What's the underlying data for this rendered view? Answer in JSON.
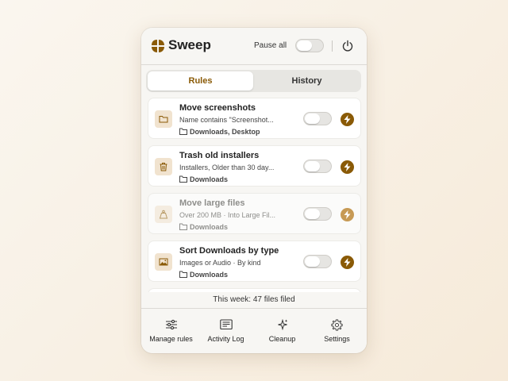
{
  "header": {
    "app_title": "Sweep",
    "pause_label": "Pause all",
    "pause_all_on": false,
    "logo_icon": "four-leaf-logo",
    "power_icon": "power-icon",
    "brand_color": "#8a5a06"
  },
  "tabs": [
    {
      "label": "Rules",
      "active": true
    },
    {
      "label": "History",
      "active": false
    }
  ],
  "rules": [
    {
      "title": "Move screenshots",
      "description": "Name contains \"Screenshot...",
      "folders": "Downloads, Desktop",
      "icon": "folder-icon",
      "enabled": false,
      "dimmed": false
    },
    {
      "title": "Trash old installers",
      "description": "Installers, Older than 30 day...",
      "folders": "Downloads",
      "icon": "trash-icon",
      "enabled": false,
      "dimmed": false
    },
    {
      "title": "Move large files",
      "description": "Over 200 MB · Into Large Fil...",
      "folders": "Downloads",
      "icon": "weight-icon",
      "enabled": false,
      "dimmed": true
    },
    {
      "title": "Sort Downloads by type",
      "description": "Images or Audio · By kind",
      "folders": "Downloads",
      "icon": "image-icon",
      "enabled": false,
      "dimmed": false
    }
  ],
  "summary": "This week: 47 files filed",
  "footer": [
    {
      "label": "Manage rules",
      "icon": "sliders-icon"
    },
    {
      "label": "Activity Log",
      "icon": "log-icon"
    },
    {
      "label": "Cleanup",
      "icon": "sparkles-icon"
    },
    {
      "label": "Settings",
      "icon": "gear-icon"
    }
  ]
}
